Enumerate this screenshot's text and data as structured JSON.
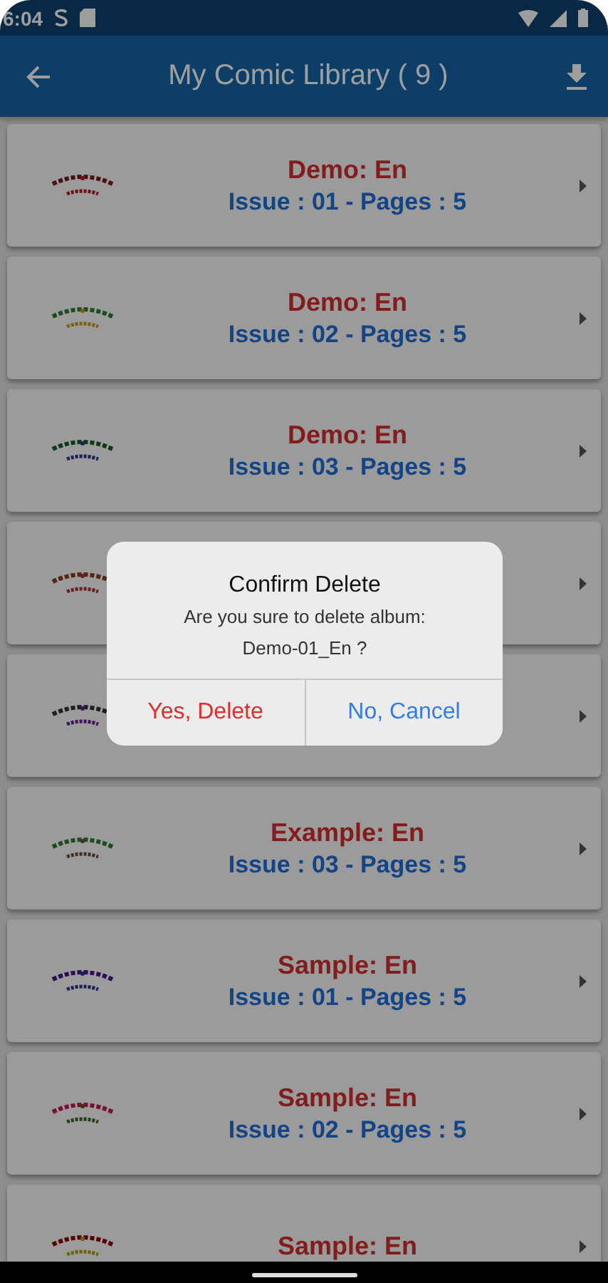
{
  "status_bar": {
    "time": "6:04"
  },
  "app_bar": {
    "title": "My Comic Library ( 9 )"
  },
  "albums": [
    {
      "thumbnail": {
        "kind": "picture"
      },
      "title": "Demo: En",
      "subtitle": "Issue : 01 - Pages : 5"
    },
    {
      "thumbnail": {
        "kind": "picture"
      },
      "title": "Demo: En",
      "subtitle": "Issue : 02 - Pages : 5"
    },
    {
      "thumbnail": {
        "kind": "picture"
      },
      "title": "Demo: En",
      "subtitle": "Issue : 03 - Pages : 5"
    },
    {
      "thumbnail": {
        "kind": "picture"
      }
    },
    {
      "thumbnail": {
        "kind": "picture"
      }
    },
    {
      "thumbnail": {
        "kind": "picture"
      },
      "title": "Example: En",
      "subtitle": "Issue : 03 - Pages : 5"
    },
    {
      "thumbnail": {
        "kind": "picture"
      },
      "title": "Sample: En",
      "subtitle": "Issue : 01 - Pages : 5"
    },
    {
      "thumbnail": {
        "kind": "picture"
      },
      "title": "Sample: En",
      "subtitle": "Issue : 02 - Pages : 5"
    },
    {
      "thumbnail": {
        "kind": "picture"
      },
      "title": "Sample: En"
    }
  ],
  "dialog": {
    "title": "Confirm Delete",
    "message": [
      "Are you sure to delete album:",
      "Demo-01_En ?"
    ],
    "buttons": [
      {
        "label": "Yes, Delete",
        "kind": "destructive"
      },
      {
        "label": "No, Cancel",
        "kind": "cancel"
      }
    ]
  }
}
